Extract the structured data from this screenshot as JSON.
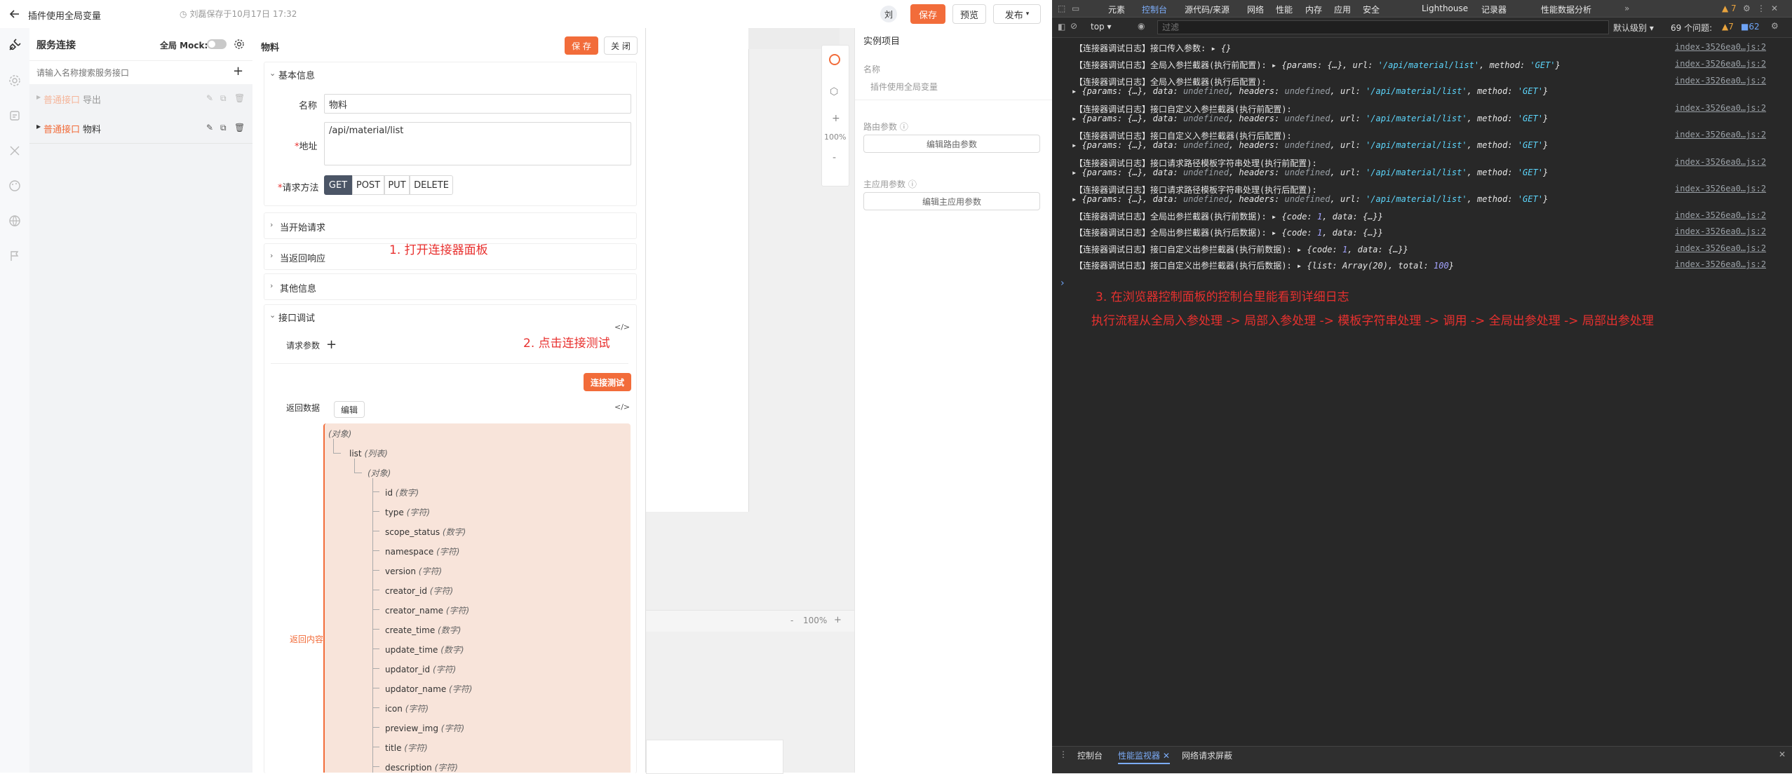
{
  "app": {
    "back_icon": "arrow-left-icon",
    "title": "插件使用全局变量",
    "autosave_text": "刘磊保存于10月17日 17:32",
    "avatar_text": "刘",
    "save_label": "保存",
    "preview_label": "预览",
    "publish_label": "发布"
  },
  "sidebar_icons": [
    "gear-icon",
    "database-icon",
    "tools-icon",
    "palette-icon",
    "globe-icon",
    "flag-icon"
  ],
  "service_panel": {
    "title": "服务连接",
    "mock_label": "全局 Mock:",
    "search_placeholder": "请输入名称搜索服务接口",
    "items": [
      {
        "tag": "普通接口",
        "name": "导出",
        "disabled": true
      },
      {
        "tag": "普通接口",
        "name": "物料",
        "disabled": false
      }
    ]
  },
  "editor": {
    "title": "物料",
    "save_label": "保 存",
    "close_label": "关 闭",
    "basic_section": "基本信息",
    "name_label": "名称",
    "name_value": "物料",
    "url_label": "地址",
    "url_value": "/api/material/list",
    "method_label": "请求方法",
    "methods": [
      "GET",
      "POST",
      "PUT",
      "DELETE"
    ],
    "active_method": "GET",
    "sections": [
      "当开始请求",
      "当返回响应",
      "其他信息"
    ],
    "debug_section": "接口调试",
    "request_params_label": "请求参数",
    "connect_test_label": "连接测试",
    "return_data_label": "返回数据",
    "edit_label": "编辑",
    "return_content_label": "返回内容",
    "code_icon": "code-icon",
    "tree": {
      "root": "(对象)",
      "list_key": "list",
      "list_type": "(列表)",
      "item_type": "(对象)",
      "fields": [
        {
          "name": "id",
          "type": "(数字)"
        },
        {
          "name": "type",
          "type": "(字符)"
        },
        {
          "name": "scope_status",
          "type": "(数字)"
        },
        {
          "name": "namespace",
          "type": "(字符)"
        },
        {
          "name": "version",
          "type": "(字符)"
        },
        {
          "name": "creator_id",
          "type": "(字符)"
        },
        {
          "name": "creator_name",
          "type": "(字符)"
        },
        {
          "name": "create_time",
          "type": "(数字)"
        },
        {
          "name": "update_time",
          "type": "(数字)"
        },
        {
          "name": "updator_id",
          "type": "(字符)"
        },
        {
          "name": "updator_name",
          "type": "(字符)"
        },
        {
          "name": "icon",
          "type": "(字符)"
        },
        {
          "name": "preview_img",
          "type": "(字符)"
        },
        {
          "name": "title",
          "type": "(字符)"
        },
        {
          "name": "description",
          "type": "(字符)"
        }
      ]
    }
  },
  "canvas": {
    "zoom": "100%",
    "zoom_in": "+",
    "zoom_out": "-",
    "bottom_zoom": "100%"
  },
  "instance_panel": {
    "title": "实例项目",
    "name_label": "名称",
    "name_value": "插件使用全局变量",
    "route_params_label": "路由参数",
    "route_params_button": "编辑路由参数",
    "main_params_label": "主应用参数",
    "main_params_button": "编辑主应用参数"
  },
  "annotations": {
    "step1": "1. 打开连接器面板",
    "step2": "2. 点击连接测试",
    "step3": "3. 在浏览器控制面板的控制台里能看到详细日志",
    "flow": "执行流程从全局入参处理  -> 局部入参处理 -> 模板字符串处理 -> 调用 -> 全局出参处理 -> 局部出参处理"
  },
  "devtools": {
    "tabs": [
      "元素",
      "控制台",
      "源代码/来源",
      "网络",
      "性能",
      "内存",
      "应用",
      "安全",
      "Lighthouse",
      "记录器",
      "性能数据分析"
    ],
    "active_tab": "控制台",
    "more_tabs": "»",
    "warn_count": "7",
    "context": "top",
    "filter_placeholder": "过滤",
    "level_label": "默认级别",
    "issues_label": "69 个问题:",
    "issue_warn": "7",
    "issue_info": "62",
    "logs": [
      {
        "text": "【连接器调试日志】接口传入参数:",
        "obj": "{}",
        "src": "index-3526ea0…js:2"
      },
      {
        "text": "【连接器调试日志】全局入参拦截器(执行前配置):",
        "obj": "{params: {…}, url: '/api/material/list', method: 'GET'}",
        "src": "index-3526ea0…js:2"
      },
      {
        "text": "【连接器调试日志】全局入参拦截器(执行后配置):",
        "obj": "{params: {…}, data: undefined, headers: undefined, url: '/api/material/list', method: 'GET'}",
        "src": "index-3526ea0…js:2"
      },
      {
        "text": "【连接器调试日志】接口自定义入参拦截器(执行前配置):",
        "obj": "{params: {…}, data: undefined, headers: undefined, url: '/api/material/list', method: 'GET'}",
        "src": "index-3526ea0…js:2"
      },
      {
        "text": "【连接器调试日志】接口自定义入参拦截器(执行后配置):",
        "obj": "{params: {…}, data: undefined, headers: undefined, url: '/api/material/list', method: 'GET'}",
        "src": "index-3526ea0…js:2"
      },
      {
        "text": "【连接器调试日志】接口请求路径模板字符串处理(执行前配置):",
        "obj": "{params: {…}, data: undefined, headers: undefined, url: '/api/material/list', method: 'GET'}",
        "src": "index-3526ea0…js:2"
      },
      {
        "text": "【连接器调试日志】接口请求路径模板字符串处理(执行后配置):",
        "obj": "{params: {…}, data: undefined, headers: undefined, url: '/api/material/list', method: 'GET'}",
        "src": "index-3526ea0…js:2"
      },
      {
        "text": "【连接器调试日志】全局出参拦截器(执行前数据):",
        "obj": "{code: 1, data: {…}}",
        "src": "index-3526ea0…js:2"
      },
      {
        "text": "【连接器调试日志】全局出参拦截器(执行后数据):",
        "obj": "{code: 1, data: {…}}",
        "src": "index-3526ea0…js:2"
      },
      {
        "text": "【连接器调试日志】接口自定义出参拦截器(执行前数据):",
        "obj": "{code: 1, data: {…}}",
        "src": "index-3526ea0…js:2"
      },
      {
        "text": "【连接器调试日志】接口自定义出参拦截器(执行后数据):",
        "obj": "{list: Array(20), total: 100}",
        "src": "index-3526ea0…js:2"
      }
    ],
    "prompt": "›",
    "drawer_tabs": [
      "控制台",
      "性能监视器",
      "网络请求屏蔽"
    ],
    "drawer_active": "性能监视器"
  }
}
